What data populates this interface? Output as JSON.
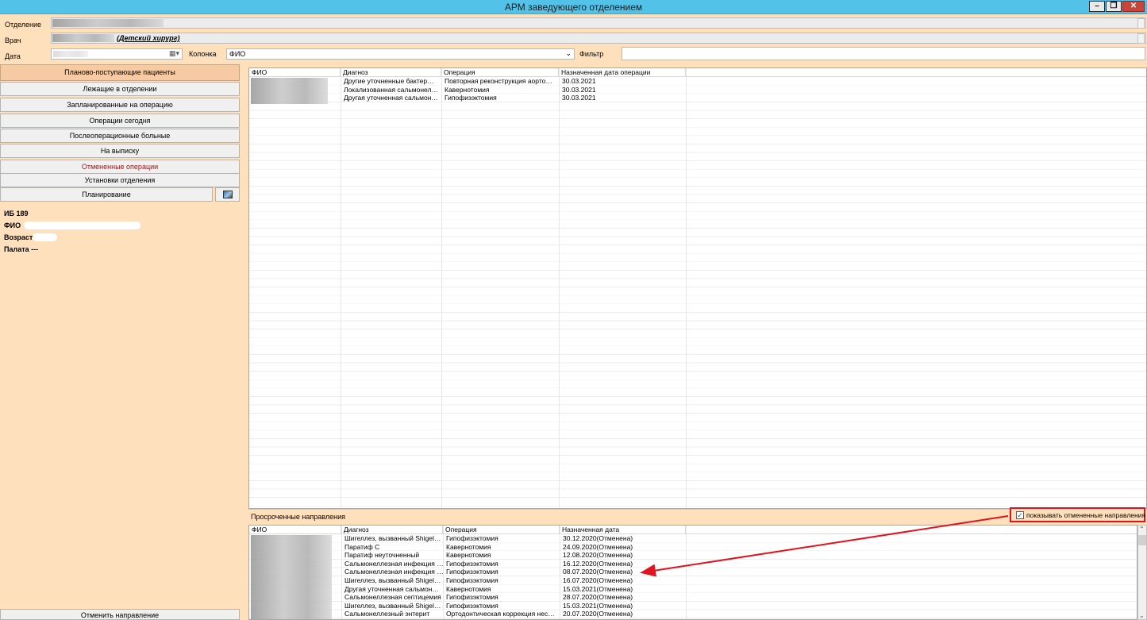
{
  "window": {
    "title": "АРМ заведующего отделением",
    "minimize": "–",
    "restore": "❐",
    "close": "✕"
  },
  "form": {
    "department_label": "Отделение",
    "doctor_label": "Врач",
    "doctor_value": "(Детский хирург)",
    "date_label": "Дата",
    "column_label": "Колонка",
    "column_value": "ФИО",
    "filter_label": "Фильтр",
    "filter_value": ""
  },
  "nav": {
    "items": [
      {
        "label": "Планово-поступающие пациенты",
        "state": "active"
      },
      {
        "label": "Лежащие в отделении",
        "state": ""
      },
      {
        "label": "Запланированные на операцию",
        "state": ""
      },
      {
        "label": "Операции сегодня",
        "state": ""
      },
      {
        "label": "Послеоперационные больные",
        "state": ""
      },
      {
        "label": "На выписку",
        "state": ""
      },
      {
        "label": "Отмененные операции",
        "state": "red"
      },
      {
        "label": "Установки отделения",
        "state": ""
      }
    ],
    "planning_label": "Планирование",
    "cancel_referral_label": "Отменить направление"
  },
  "patient_info": {
    "ib": "ИБ 189",
    "fio": "ФИО",
    "age": "Возраст",
    "ward": "Палата ---"
  },
  "main_table": {
    "columns": [
      "ФИО",
      "Диагноз",
      "Операция",
      "Назначенная дата операции"
    ],
    "rows": [
      {
        "fio": "",
        "diagnosis": "Другие уточненные бактер…",
        "operation": "Повторная реконструкция аорто…",
        "date": "30.03.2021"
      },
      {
        "fio": "",
        "diagnosis": "Локализованная сальмонел…",
        "operation": "Кавернотомия",
        "date": "30.03.2021"
      },
      {
        "fio": "",
        "diagnosis": "Другая уточненная сальмон…",
        "operation": "Гипофизэктомия",
        "date": "30.03.2021"
      }
    ]
  },
  "overdue": {
    "section_title": "Просроченные направления",
    "show_cancelled_label": "показывать отмененные направления",
    "show_cancelled_checked": true,
    "columns": [
      "ФИО",
      "Диагноз",
      "Операция",
      "Назначенная дата"
    ],
    "rows": [
      {
        "diagnosis": "Шигеллез, вызванный Shigel…",
        "operation": "Гипофизэктомия",
        "date": "30.12.2020(Отменена)"
      },
      {
        "diagnosis": "Паратиф C",
        "operation": "Кавернотомия",
        "date": "24.09.2020(Отменена)"
      },
      {
        "diagnosis": "Паратиф неуточненный",
        "operation": "Кавернотомия",
        "date": "12.08.2020(Отменена)"
      },
      {
        "diagnosis": "Сальмонеллезная инфекция …",
        "operation": "Гипофизэктомия",
        "date": "16.12.2020(Отменена)"
      },
      {
        "diagnosis": "Сальмонеллезная инфекция …",
        "operation": "Гипофизэктомия",
        "date": "08.07.2020(Отменена)"
      },
      {
        "diagnosis": "Шигеллез, вызванный Shigel…",
        "operation": "Гипофизэктомия",
        "date": "16.07.2020(Отменена)"
      },
      {
        "diagnosis": "Другая уточненная сальмон…",
        "operation": "Кавернотомия",
        "date": "15.03.2021(Отменена)"
      },
      {
        "diagnosis": "Сальмонеллезная септицемия",
        "operation": "Гипофизэктомия",
        "date": "28.07.2020(Отменена)"
      },
      {
        "diagnosis": "Шигеллез, вызванный Shigel…",
        "operation": "Гипофизэктомия",
        "date": "15.03.2021(Отменена)"
      },
      {
        "diagnosis": "Сальмонеллезный энтерит",
        "operation": "Ортодонтическая коррекция нес…",
        "date": "20.07.2020(Отменена)"
      }
    ]
  },
  "colors": {
    "titlebar": "#52c2e8",
    "panel": "#ffe0bd",
    "active_nav": "#f6caa2",
    "highlight": "#e0141e"
  }
}
